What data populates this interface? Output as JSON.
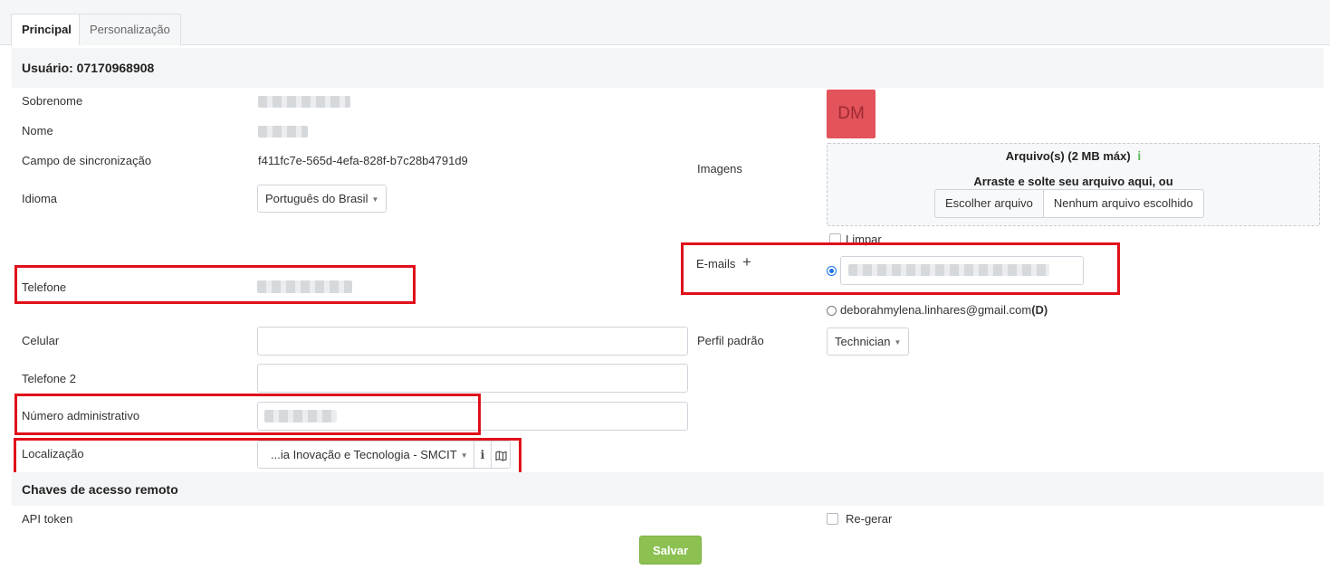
{
  "tabs": [
    {
      "label": "Principal",
      "active": true
    },
    {
      "label": "Personalização",
      "active": false
    }
  ],
  "user_header": "Usuário: 07170968908",
  "fields": {
    "sobrenome_label": "Sobrenome",
    "nome_label": "Nome",
    "sync_label": "Campo de sincronização",
    "sync_value": "f411fc7e-565d-4efa-828f-b7c28b4791d9",
    "idioma_label": "Idioma",
    "idioma_value": "Português do Brasil",
    "telefone_label": "Telefone",
    "celular_label": "Celular",
    "telefone2_label": "Telefone 2",
    "numero_admin_label": "Número administrativo",
    "localizacao_label": "Localização",
    "localizacao_value": "...ia Inovação e Tecnologia - SMCIT"
  },
  "right": {
    "imagens_label": "Imagens",
    "avatar_initials": "DM",
    "upload_title": "Arquivo(s) (2 MB máx)",
    "upload_info_icon": "i",
    "upload_drag": "Arraste e solte seu arquivo aqui, ou",
    "choose_file": "Escolher arquivo",
    "no_file": "Nenhum arquivo escolhido",
    "limpar_label": "Limpar",
    "emails_label": "E-mails",
    "add_icon": "+",
    "secondary_email": "deborahmylena.linhares@gmail.com",
    "secondary_email_suffix": "(D)",
    "perfil_label": "Perfil padrão",
    "perfil_value": "Technician"
  },
  "remote": {
    "header": "Chaves de acesso remoto",
    "api_label": "API token",
    "regerar_label": "Re-gerar"
  },
  "save_label": "Salvar",
  "colors": {
    "avatar_bg": "#e2535c",
    "save_bg": "#8cc152",
    "highlight": "#e0101a"
  }
}
